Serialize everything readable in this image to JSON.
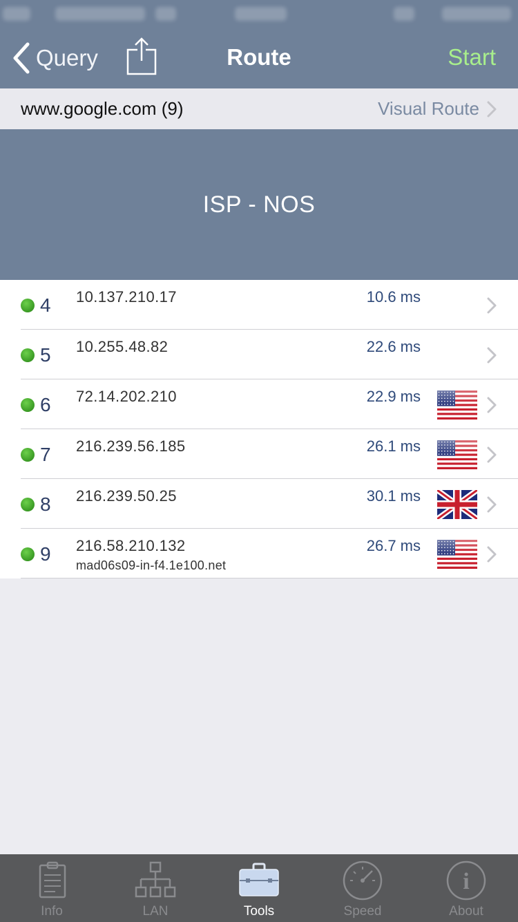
{
  "nav": {
    "back_label": "Query",
    "title": "Route",
    "start_label": "Start"
  },
  "host_row": {
    "host": "www.google.com (9)",
    "visual_route_label": "Visual Route"
  },
  "isp": {
    "label": "ISP - NOS"
  },
  "hops": [
    {
      "num": "4",
      "ip": "10.137.210.17",
      "ms": "10.6 ms",
      "hostname": "",
      "flag": "none",
      "status_color": "#4caf35"
    },
    {
      "num": "5",
      "ip": "10.255.48.82",
      "ms": "22.6 ms",
      "hostname": "",
      "flag": "none",
      "status_color": "#4caf35"
    },
    {
      "num": "6",
      "ip": "72.14.202.210",
      "ms": "22.9 ms",
      "hostname": "",
      "flag": "us",
      "status_color": "#4caf35"
    },
    {
      "num": "7",
      "ip": "216.239.56.185",
      "ms": "26.1 ms",
      "hostname": "",
      "flag": "us",
      "status_color": "#4caf35"
    },
    {
      "num": "8",
      "ip": "216.239.50.25",
      "ms": "30.1 ms",
      "hostname": "",
      "flag": "uk",
      "status_color": "#4caf35"
    },
    {
      "num": "9",
      "ip": "216.58.210.132",
      "ms": "26.7 ms",
      "hostname": "mad06s09-in-f4.1e100.net",
      "flag": "us",
      "status_color": "#4caf35"
    }
  ],
  "tabs": [
    {
      "label": "Info",
      "icon": "clipboard-icon",
      "active": false
    },
    {
      "label": "LAN",
      "icon": "network-icon",
      "active": false
    },
    {
      "label": "Tools",
      "icon": "toolbox-icon",
      "active": true
    },
    {
      "label": "Speed",
      "icon": "speedometer-icon",
      "active": false
    },
    {
      "label": "About",
      "icon": "info-icon",
      "active": false
    }
  ],
  "colors": {
    "header_bg": "#6f8199",
    "start_green": "#a8ee8c",
    "tabbar_bg": "#58595b"
  }
}
